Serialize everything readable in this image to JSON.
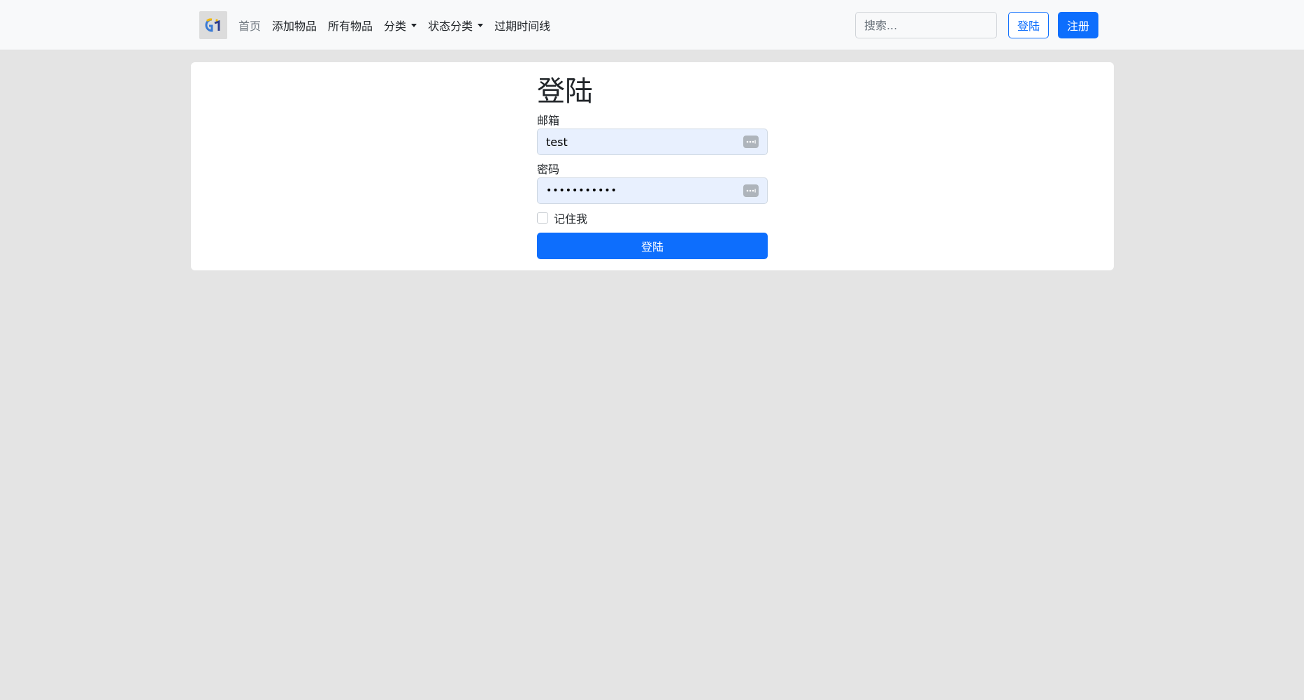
{
  "navbar": {
    "logo_icon": "app-logo-icon",
    "links": {
      "home": "首页",
      "add_item": "添加物品",
      "all_items": "所有物品",
      "category": "分类",
      "status_category": "状态分类",
      "expiry_timeline": "过期时间线"
    },
    "search_placeholder": "搜索...",
    "login_label": "登陆",
    "register_label": "注册"
  },
  "login_form": {
    "title": "登陆",
    "email_label": "邮箱",
    "email_value": "test",
    "password_label": "密码",
    "password_value": "•••••••••••",
    "remember_label": "记住我",
    "remember_checked": false,
    "submit_label": "登陆",
    "autofill_icon": "autofill-key-icon"
  },
  "colors": {
    "primary": "#0d6efd",
    "navbar_bg": "#f8f9fa",
    "page_bg": "#e4e4e4",
    "autofill_bg": "#e8f0fe"
  }
}
